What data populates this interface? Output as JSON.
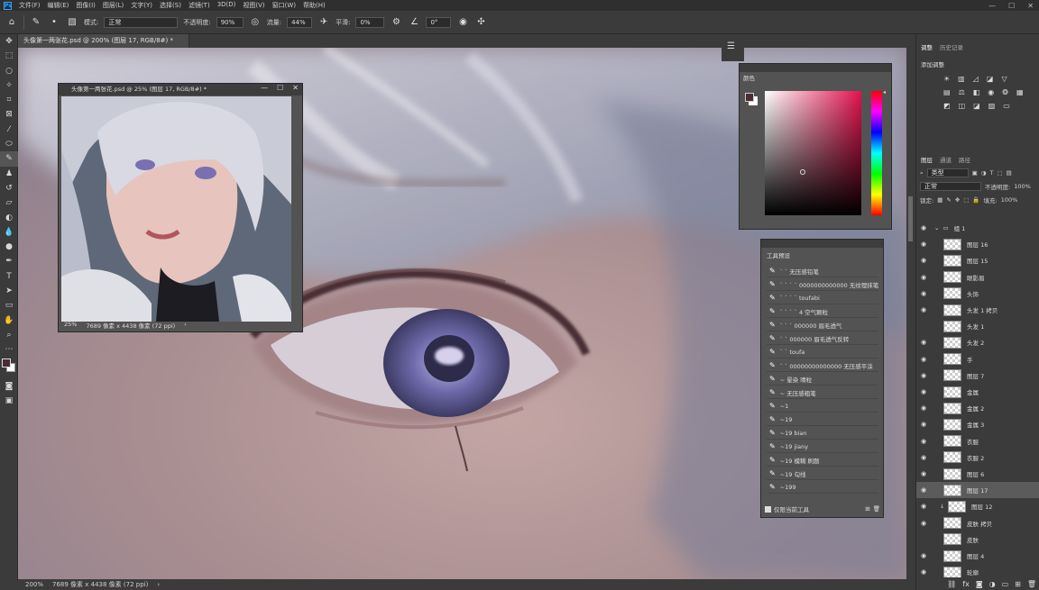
{
  "menu": [
    "文件(F)",
    "编辑(E)",
    "图像(I)",
    "图层(L)",
    "文字(Y)",
    "选择(S)",
    "滤镜(T)",
    "3D(D)",
    "视图(V)",
    "窗口(W)",
    "帮助(H)"
  ],
  "options": {
    "mode_label": "模式:",
    "mode_value": "正常",
    "opacity_label": "不透明度:",
    "opacity_value": "90%",
    "flow_label": "流量:",
    "flow_value": "44%",
    "smooth_label": "平滑:",
    "smooth_value": "0%",
    "angle_value": "0°"
  },
  "doc_tab": "头像第一两张花.psd @ 200% (图层 17, RGB/8#) *",
  "nav": {
    "title": "头像第一两张花.psd @ 25% (图层 17, RGB/8#) *",
    "zoom": "25%",
    "size": "7689 像素 x 4438 像素 (72 ppi)"
  },
  "status": {
    "zoom": "200%",
    "size": "7689 像素 x 4438 像素 (72 ppi)"
  },
  "color_panel": {
    "tab": "颜色",
    "fg": "#4a2c33",
    "bg": "#ffffff"
  },
  "brushes": {
    "tab": "工具预设",
    "items": [
      "` ` 无压感铅笔",
      "` ` ` ` 0000000000000 无纹理抹笔",
      "` ` ` ` toufabi",
      "` ` ` ` 4 空气颗粒",
      "` ` ` 000000 眉毛透气",
      "` ` 000000 眉毛透气反转",
      "` ` toufa",
      "` ` 00000000000000 无压感平涂",
      "~ 晕染 晴粒",
      "~ 无压感粗笔",
      "~1",
      "~19",
      "~19 bian",
      "~19 jiany",
      "~19 模糊 刷题",
      "~19 勾线",
      "~199"
    ],
    "footer": "仅限当前工具"
  },
  "right_panel": {
    "tabs": [
      "调整",
      "历史记录"
    ],
    "add_adjust": "添加调整",
    "layer_tabs": [
      "图层",
      "通道",
      "路径"
    ],
    "kind": "类型",
    "blend": "正常",
    "opacity_label": "不透明度:",
    "opacity": "100%",
    "lock_label": "锁定:",
    "fill_label": "填充:",
    "fill": "100%"
  },
  "layers": [
    {
      "name": "组 1",
      "group": true
    },
    {
      "name": "图层 16"
    },
    {
      "name": "图层 15"
    },
    {
      "name": "眼影眉"
    },
    {
      "name": "头饰"
    },
    {
      "name": "头发 1 拷贝"
    },
    {
      "name": "头发 1"
    },
    {
      "name": "头发 2"
    },
    {
      "name": "手"
    },
    {
      "name": "图层 7"
    },
    {
      "name": "金属"
    },
    {
      "name": "金属 2"
    },
    {
      "name": "金属 3"
    },
    {
      "name": "衣服"
    },
    {
      "name": "衣服 2"
    },
    {
      "name": "图层 6"
    },
    {
      "name": "图层 17",
      "selected": true
    },
    {
      "name": "图层 12"
    },
    {
      "name": "皮肤 拷贝"
    },
    {
      "name": "皮肤"
    },
    {
      "name": "图层 4"
    },
    {
      "name": "轮廓"
    }
  ]
}
